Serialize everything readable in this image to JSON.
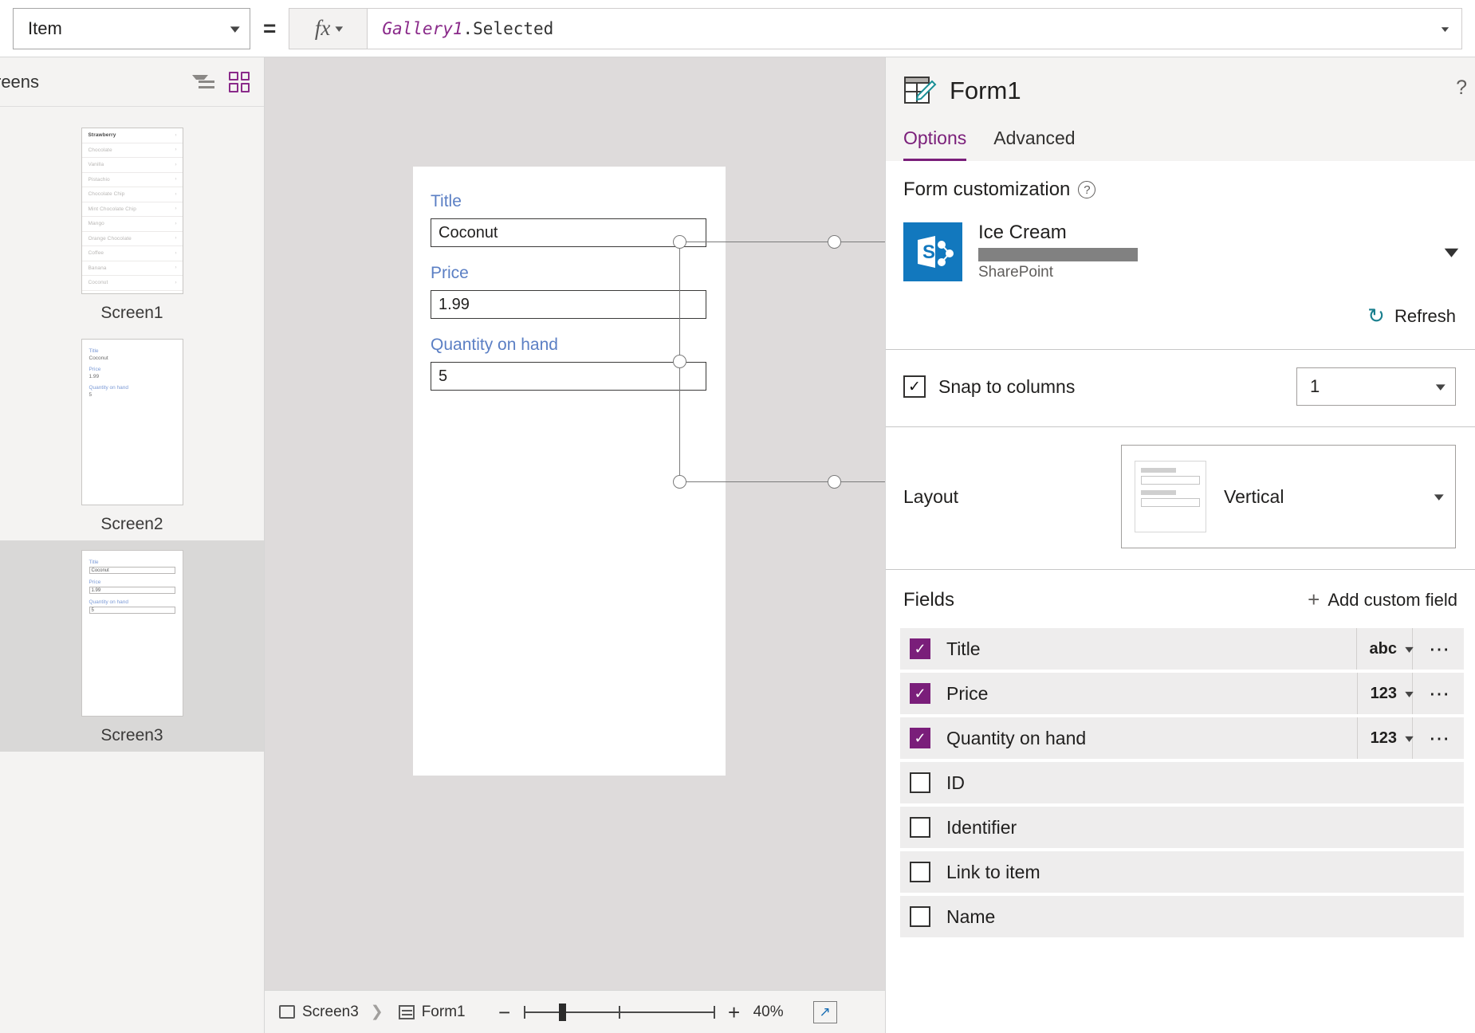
{
  "formula_bar": {
    "property": "Item",
    "equals": "=",
    "fx_glyph": "fx",
    "formula_object": "Gallery1",
    "formula_property": ".Selected"
  },
  "left_panel": {
    "title": "reens",
    "screens": [
      {
        "label": "Screen1",
        "type": "gallery",
        "items": [
          "Strawberry",
          "Chocolate",
          "Vanilla",
          "Pistachio",
          "Chocolate Chip",
          "Mint Chocolate Chip",
          "Mango",
          "Orange Chocolate",
          "Coffee",
          "Banana",
          "Coconut"
        ]
      },
      {
        "label": "Screen2",
        "type": "display-form",
        "fields": [
          {
            "label": "Title",
            "value": "Coconut"
          },
          {
            "label": "Price",
            "value": "1.99"
          },
          {
            "label": "Quantity on hand",
            "value": "5"
          }
        ]
      },
      {
        "label": "Screen3",
        "type": "edit-form",
        "selected": true,
        "fields": [
          {
            "label": "Title",
            "value": "Coconut"
          },
          {
            "label": "Price",
            "value": "1.99"
          },
          {
            "label": "Quantity on hand",
            "value": "5"
          }
        ]
      }
    ]
  },
  "canvas": {
    "form_fields": [
      {
        "label": "Title",
        "value": "Coconut"
      },
      {
        "label": "Price",
        "value": "1.99"
      },
      {
        "label": "Quantity on hand",
        "value": "5"
      }
    ]
  },
  "statusbar": {
    "breadcrumb_screen": "Screen3",
    "breadcrumb_control": "Form1",
    "zoom_out": "−",
    "zoom_in": "+",
    "zoom_level": "40%"
  },
  "right_panel": {
    "title": "Form1",
    "help": "?",
    "tabs": [
      {
        "label": "Options",
        "active": true
      },
      {
        "label": "Advanced",
        "active": false
      }
    ],
    "form_customization": {
      "section_title": "Form customization",
      "data_source_name": "Ice Cream",
      "data_source_type": "SharePoint",
      "refresh_label": "Refresh"
    },
    "snap": {
      "label": "Snap to columns",
      "checked": true,
      "columns": "1"
    },
    "layout": {
      "label": "Layout",
      "value": "Vertical"
    },
    "fields_section": {
      "title": "Fields",
      "add_label": "Add custom field",
      "rows": [
        {
          "name": "Title",
          "checked": true,
          "type": "abc"
        },
        {
          "name": "Price",
          "checked": true,
          "type": "123"
        },
        {
          "name": "Quantity on hand",
          "checked": true,
          "type": "123"
        },
        {
          "name": "ID",
          "checked": false,
          "type": ""
        },
        {
          "name": "Identifier",
          "checked": false,
          "type": ""
        },
        {
          "name": "Link to item",
          "checked": false,
          "type": ""
        },
        {
          "name": "Name",
          "checked": false,
          "type": ""
        }
      ]
    }
  },
  "colors": {
    "accent_purple": "#7a1e7a",
    "form_label_blue": "#5b7fc4",
    "sharepoint_blue": "#1278be",
    "teal": "#1a7f8e"
  }
}
